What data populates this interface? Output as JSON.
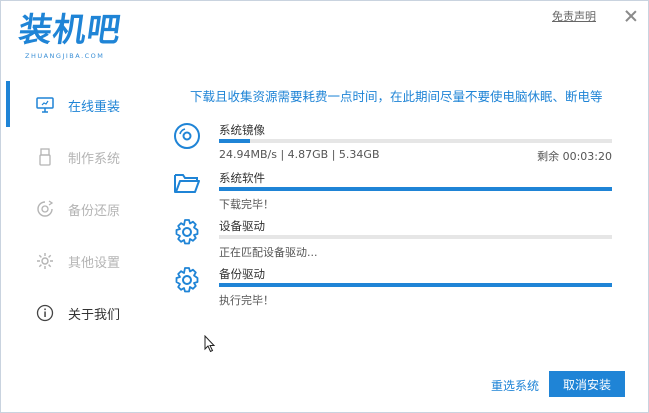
{
  "logo": {
    "title": "装机吧",
    "subtitle": "ZHUANGJIBA.COM"
  },
  "header": {
    "disclaimer": "免责声明"
  },
  "sidebar": {
    "items": [
      {
        "label": "在线重装",
        "icon": "monitor-icon"
      },
      {
        "label": "制作系统",
        "icon": "usb-icon"
      },
      {
        "label": "备份还原",
        "icon": "backup-icon"
      },
      {
        "label": "其他设置",
        "icon": "gear-icon"
      },
      {
        "label": "关于我们",
        "icon": "info-icon"
      }
    ]
  },
  "main": {
    "notice": "下载且收集资源需要耗费一点时间，在此期间尽量不要使电脑休眠、断电等",
    "tasks": [
      {
        "name": "系统镜像",
        "status": "24.94MB/s | 4.87GB | 5.34GB",
        "remaining": "剩余 00:03:20",
        "progress": 0.08,
        "icon": "disc-icon"
      },
      {
        "name": "系统软件",
        "status": "下载完毕！",
        "progress": 1.0,
        "icon": "folder-icon"
      },
      {
        "name": "设备驱动",
        "status": "正在匹配设备驱动...",
        "progress": 0.0,
        "icon": "gear-icon"
      },
      {
        "name": "备份驱动",
        "status": "执行完毕！",
        "progress": 1.0,
        "icon": "backup-gear-icon"
      }
    ]
  },
  "footer": {
    "reselect": "重选系统",
    "cancel": "取消安装"
  },
  "colors": {
    "accent": "#1f84d6",
    "inactive": "#b4b4b4",
    "track": "#e6e6e6"
  }
}
